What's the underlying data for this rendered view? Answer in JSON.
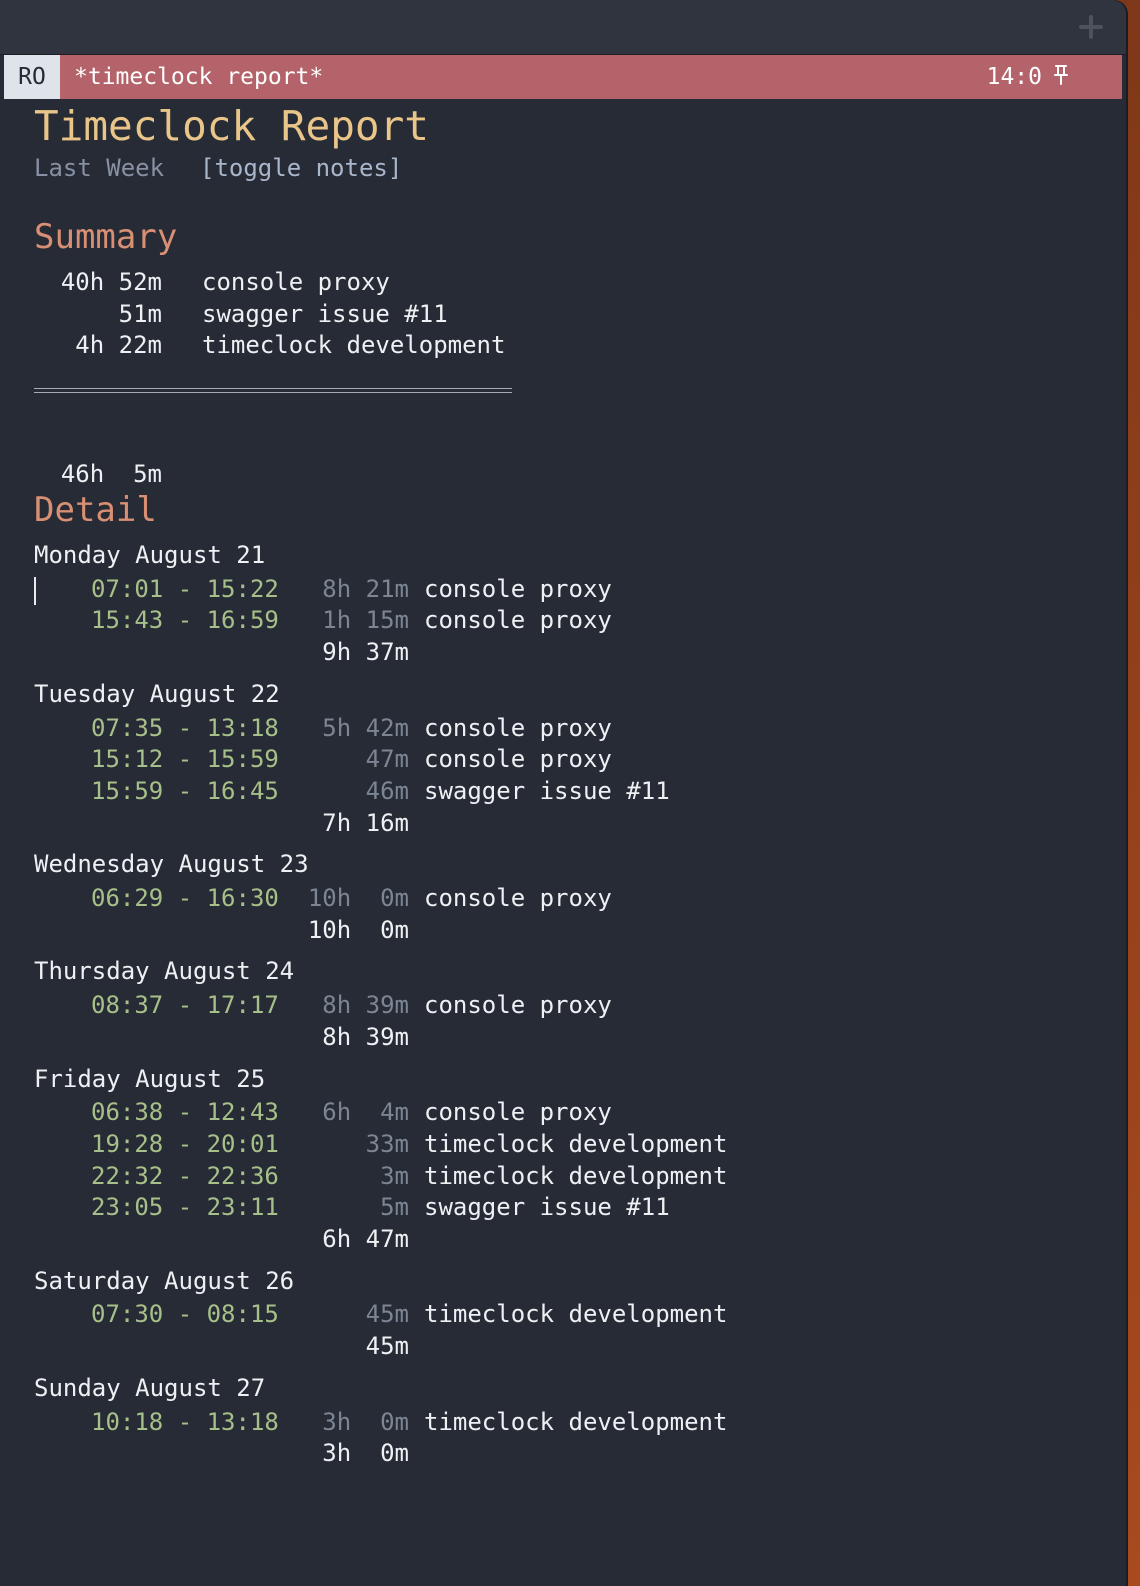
{
  "modeline": {
    "mode": "RO",
    "buffer": "*timeclock report*",
    "position": "14:0"
  },
  "report": {
    "title": "Timeclock Report",
    "period": "Last Week",
    "toggle": "[toggle notes]"
  },
  "summary": {
    "heading": "Summary",
    "rows": [
      {
        "time": "40h 52m",
        "project": "console proxy"
      },
      {
        "time": "51m",
        "project": "swagger issue #11"
      },
      {
        "time": "4h 22m",
        "project": "timeclock development"
      }
    ],
    "total": "46h  5m"
  },
  "detail": {
    "heading": "Detail",
    "days": [
      {
        "label": "Monday August 21",
        "entries": [
          {
            "range": "07:01 - 15:22",
            "duration": "8h 21m",
            "project": "console proxy"
          },
          {
            "range": "15:43 - 16:59",
            "duration": "1h 15m",
            "project": "console proxy"
          }
        ],
        "total": "9h 37m"
      },
      {
        "label": "Tuesday August 22",
        "entries": [
          {
            "range": "07:35 - 13:18",
            "duration": "5h 42m",
            "project": "console proxy"
          },
          {
            "range": "15:12 - 15:59",
            "duration": "47m",
            "project": "console proxy"
          },
          {
            "range": "15:59 - 16:45",
            "duration": "46m",
            "project": "swagger issue #11"
          }
        ],
        "total": "7h 16m"
      },
      {
        "label": "Wednesday August 23",
        "entries": [
          {
            "range": "06:29 - 16:30",
            "duration": "10h  0m",
            "project": "console proxy"
          }
        ],
        "total": "10h  0m"
      },
      {
        "label": "Thursday August 24",
        "entries": [
          {
            "range": "08:37 - 17:17",
            "duration": "8h 39m",
            "project": "console proxy"
          }
        ],
        "total": "8h 39m"
      },
      {
        "label": "Friday August 25",
        "entries": [
          {
            "range": "06:38 - 12:43",
            "duration": "6h  4m",
            "project": "console proxy"
          },
          {
            "range": "19:28 - 20:01",
            "duration": "33m",
            "project": "timeclock development"
          },
          {
            "range": "22:32 - 22:36",
            "duration": "3m",
            "project": "timeclock development"
          },
          {
            "range": "23:05 - 23:11",
            "duration": "5m",
            "project": "swagger issue #11"
          }
        ],
        "total": "6h 47m"
      },
      {
        "label": "Saturday August 26",
        "entries": [
          {
            "range": "07:30 - 08:15",
            "duration": "45m",
            "project": "timeclock development"
          }
        ],
        "total": "45m"
      },
      {
        "label": "Sunday August 27",
        "entries": [
          {
            "range": "10:18 - 13:18",
            "duration": "3h  0m",
            "project": "timeclock development"
          }
        ],
        "total": "3h  0m"
      }
    ]
  }
}
